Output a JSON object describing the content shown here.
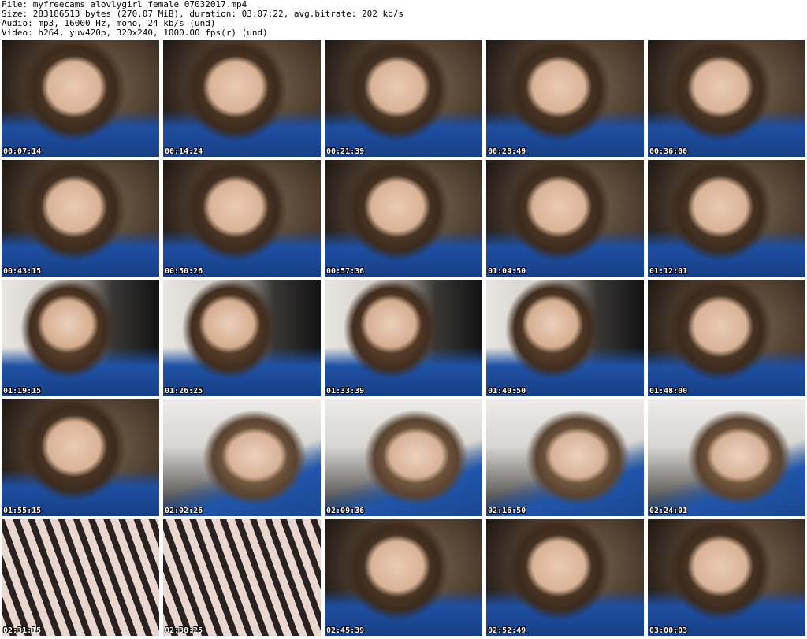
{
  "header": {
    "file_line": "File: myfreecams_alovlygirl_female_07032017.mp4",
    "size_line": "Size: 283186513 bytes (270.07 MiB), duration: 03:07:22, avg.bitrate: 202 kb/s",
    "audio_line": "Audio: mp3, 16000 Hz, mono, 24 kb/s (und)",
    "video_line": "Video: h264, yuv420p, 320x240, 1000.00 fps(r) (und)"
  },
  "thumbnails": [
    {
      "timestamp": "00:07:14"
    },
    {
      "timestamp": "00:14:24"
    },
    {
      "timestamp": "00:21:39"
    },
    {
      "timestamp": "00:28:49"
    },
    {
      "timestamp": "00:36:00"
    },
    {
      "timestamp": "00:43:15"
    },
    {
      "timestamp": "00:50:26"
    },
    {
      "timestamp": "00:57:36"
    },
    {
      "timestamp": "01:04:50"
    },
    {
      "timestamp": "01:12:01"
    },
    {
      "timestamp": "01:19:15"
    },
    {
      "timestamp": "01:26:25"
    },
    {
      "timestamp": "01:33:39"
    },
    {
      "timestamp": "01:40:50"
    },
    {
      "timestamp": "01:48:00"
    },
    {
      "timestamp": "01:55:15"
    },
    {
      "timestamp": "02:02:26"
    },
    {
      "timestamp": "02:09:36"
    },
    {
      "timestamp": "02:16:50"
    },
    {
      "timestamp": "02:24:01"
    },
    {
      "timestamp": "02:31:15"
    },
    {
      "timestamp": "02:38:25"
    },
    {
      "timestamp": "02:45:39"
    },
    {
      "timestamp": "02:52:49"
    },
    {
      "timestamp": "03:00:03"
    }
  ]
}
